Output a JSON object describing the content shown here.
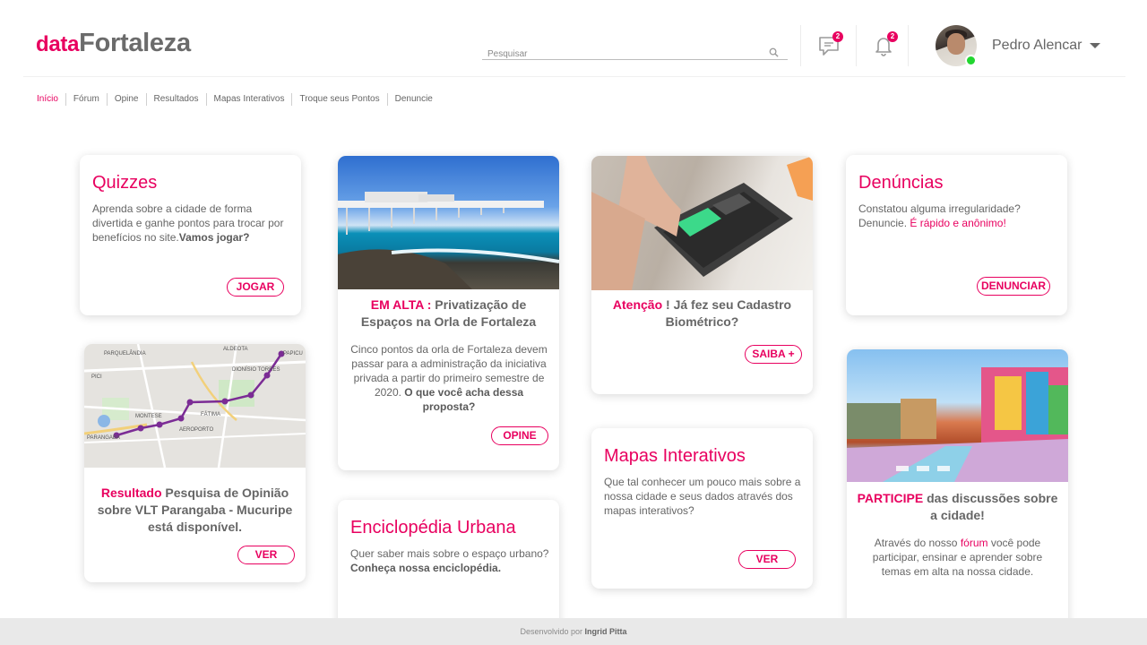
{
  "header": {
    "logo_part1": "data",
    "logo_part2": "Fortaleza",
    "search_placeholder": "Pesquisar",
    "messages_count": "2",
    "notifications_count": "2",
    "username": "Pedro Alencar"
  },
  "colors": {
    "accent": "#e8005f",
    "online": "#22d630"
  },
  "icons": [
    "search-icon",
    "chat-icon",
    "bell-icon",
    "caret-down-icon"
  ],
  "nav": {
    "items": [
      "Início",
      "Fórum",
      "Opine",
      "Resultados",
      "Mapas Interativos",
      "Troque seus Pontos",
      "Denuncie"
    ]
  },
  "cards": {
    "quizzes": {
      "title": "Quizzes",
      "text": "Aprenda sobre a cidade de forma divertida e ganhe pontos para trocar por benefícios no site.",
      "text_bold": "Vamos jogar?",
      "button": "JOGAR"
    },
    "resultado": {
      "title_highlight": "Resultado",
      "title": " Pesquisa de Opinião sobre VLT Parangaba - Mucuripe está disponível.",
      "button": "VER",
      "map_labels": [
        "PARQUELÂNDIA",
        "ALDEOTA",
        "PICI",
        "DIONÍSIO TORRES",
        "MONTESE",
        "FÁTIMA",
        "PARANGABA",
        "AEROPORTO",
        "PAPICU"
      ]
    },
    "em_alta": {
      "title_highlight": "EM ALTA :",
      "title": " Privatização de Espaços na Orla de Fortaleza",
      "text": "Cinco pontos da orla de Fortaleza devem passar para a administração da iniciativa privada a partir do primeiro semestre de 2020.",
      "text_bold": " O que você acha dessa proposta?",
      "button": "OPINE"
    },
    "enciclopedia": {
      "title": "Enciclopédia Urbana",
      "text": "Quer saber mais sobre o espaço urbano?",
      "text_bold": "Conheça nossa enciclopédia."
    },
    "atencao": {
      "title_highlight": "Atenção",
      "title": " ! Já fez seu Cadastro Biométrico?",
      "button": "SAIBA +"
    },
    "mapas": {
      "title": "Mapas Interativos",
      "text": "Que tal conhecer um pouco mais sobre a nossa cidade e seus dados através dos mapas interativos?",
      "button": "VER"
    },
    "denuncias": {
      "title": "Denúncias",
      "text": "Constatou alguma irregularidade? Denuncie.",
      "text_highlight": " É rápido e anônimo!",
      "button": "DENUNCIAR"
    },
    "participe": {
      "title_highlight": "PARTICIPE",
      "title": " das discussões sobre a cidade!",
      "text_before": "Através do nosso ",
      "text_link": "fórum",
      "text_after": " você pode participar, ensinar e aprender sobre temas em alta na nossa cidade."
    }
  },
  "footer": {
    "text": "Desenvolvido por ",
    "author": "Ingrid Pitta"
  }
}
